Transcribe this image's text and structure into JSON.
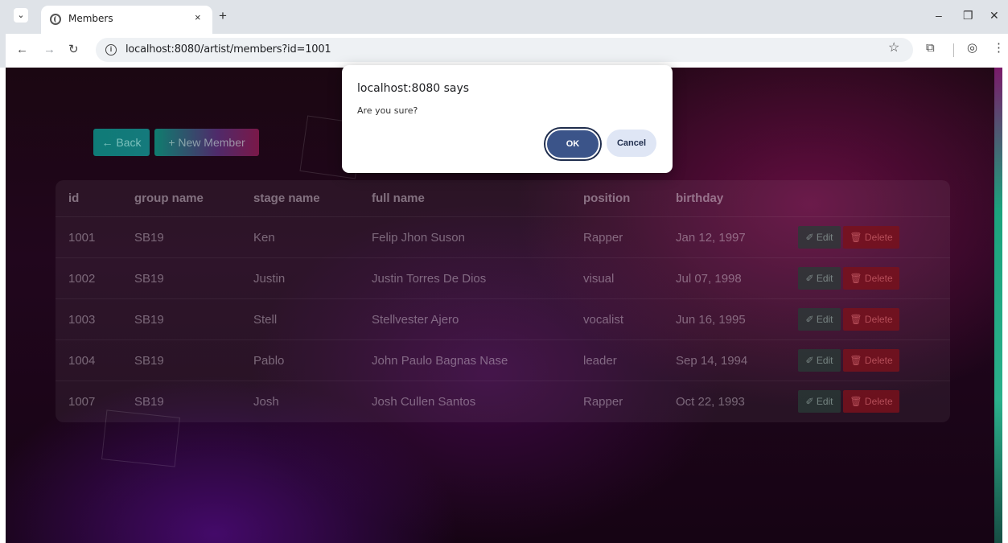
{
  "browser": {
    "tab_title": "Members",
    "tab_close": "×",
    "new_tab": "+",
    "url": "localhost:8080/artist/members?id=1001",
    "icons": [
      "tab-menu-icon",
      "globe-icon",
      "back-arrow-icon",
      "forward-arrow-icon",
      "reload-icon",
      "info-icon",
      "star-icon",
      "extensions-icon",
      "profile-icon",
      "more-icon",
      "minimize-icon",
      "restore-icon",
      "close-icon"
    ]
  },
  "page": {
    "back_label": "← Back",
    "new_member_label": "+ New Member",
    "table": {
      "headers": {
        "id": "id",
        "group": "group name",
        "stage": "stage name",
        "full": "full name",
        "position": "position",
        "birthday": "birthday"
      },
      "rows": [
        {
          "id": "1001",
          "group": "SB19",
          "stage": "Ken",
          "full": "Felip Jhon Suson",
          "position": "Rapper",
          "birthday": "Jan 12, 1997"
        },
        {
          "id": "1002",
          "group": "SB19",
          "stage": "Justin",
          "full": "Justin Torres De Dios",
          "position": "visual",
          "birthday": "Jul 07, 1998"
        },
        {
          "id": "1003",
          "group": "SB19",
          "stage": "Stell",
          "full": "Stellvester Ajero",
          "position": "vocalist",
          "birthday": "Jun 16, 1995"
        },
        {
          "id": "1004",
          "group": "SB19",
          "stage": "Pablo",
          "full": "John Paulo Bagnas Nase",
          "position": "leader",
          "birthday": "Sep 14, 1994"
        },
        {
          "id": "1007",
          "group": "SB19",
          "stage": "Josh",
          "full": "Josh Cullen Santos",
          "position": "Rapper",
          "birthday": "Oct 22, 1993"
        }
      ],
      "edit_label": "✐ Edit",
      "delete_label": "🗑 Delete"
    }
  },
  "dialog": {
    "title": "localhost:8080 says",
    "message": "Are you sure?",
    "ok_label": "OK",
    "cancel_label": "Cancel"
  },
  "colors": {
    "ok_button": "#3b5489",
    "cancel_button": "#dfe6f5",
    "delete_button": "#78121c",
    "back_button": "#0f7b77"
  }
}
